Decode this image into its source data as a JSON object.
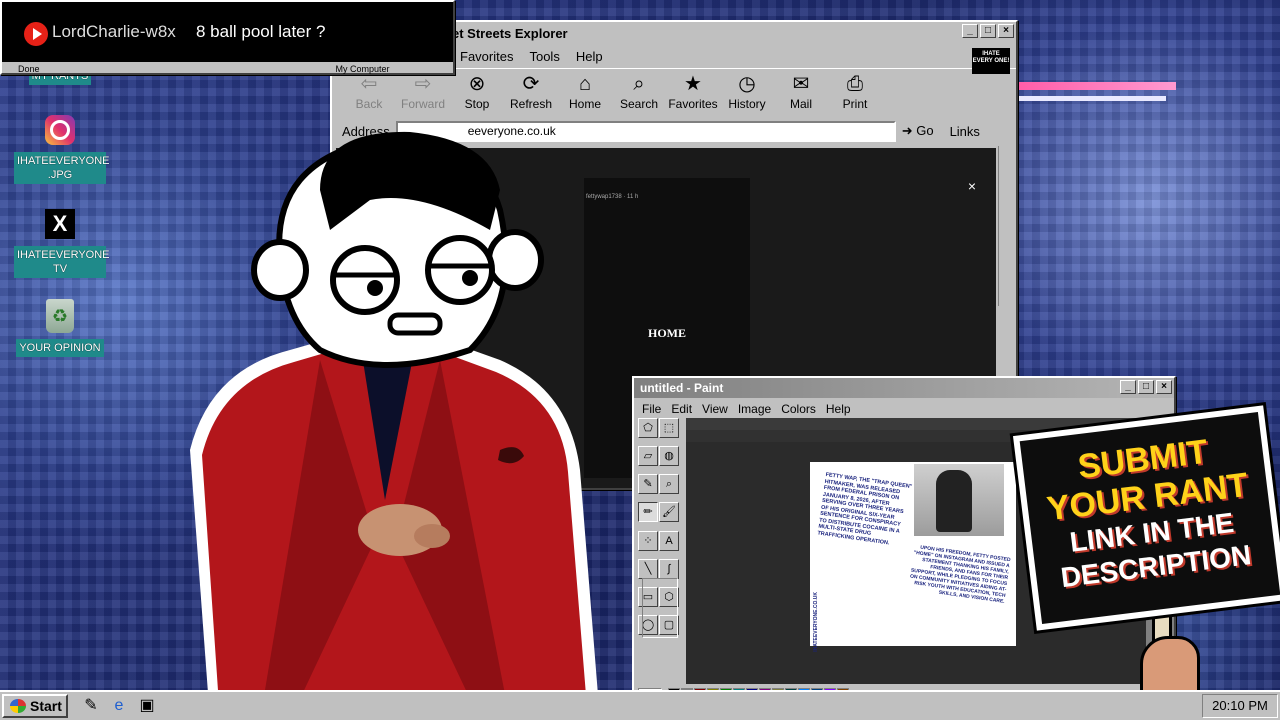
{
  "notification": {
    "username": "LordCharlie-w8x",
    "message": "8 ball pool later ?",
    "status_left": "Done",
    "status_right": "My Computer"
  },
  "desktop": {
    "icons": [
      {
        "label": "MY RANTS",
        "icon": "rants-icon"
      },
      {
        "label": "IHATEEVERYONE .JPG",
        "icon": "instagram-icon"
      },
      {
        "label": "IHATEEVERYONE TV",
        "icon": "x-logo-icon"
      },
      {
        "label": "YOUR OPINION",
        "icon": "recycle-bin-icon"
      }
    ]
  },
  "browser": {
    "title": "et Streets Explorer",
    "logo_text": "IHATE EVERY ONE!",
    "menu": [
      "Favorites",
      "Tools",
      "Help"
    ],
    "toolbar": [
      {
        "label": "Back",
        "icon": "back-arrow-icon",
        "enabled": false
      },
      {
        "label": "Forward",
        "icon": "forward-arrow-icon",
        "enabled": false
      },
      {
        "label": "Stop",
        "icon": "stop-icon",
        "enabled": true
      },
      {
        "label": "Refresh",
        "icon": "refresh-icon",
        "enabled": true
      },
      {
        "label": "Home",
        "icon": "home-icon",
        "enabled": true
      },
      {
        "label": "Search",
        "icon": "search-icon",
        "enabled": true
      },
      {
        "label": "Favorites",
        "icon": "favorites-icon",
        "enabled": true
      },
      {
        "label": "History",
        "icon": "history-icon",
        "enabled": true
      },
      {
        "label": "Mail",
        "icon": "mail-icon",
        "enabled": true
      },
      {
        "label": "Print",
        "icon": "print-icon",
        "enabled": true
      }
    ],
    "address_label": "Address",
    "address_value": "eeveryone.co.uk",
    "go_label": "Go",
    "links_label": "Links",
    "page": {
      "story_user": "fettywap1738",
      "story_time": "11 h",
      "home_text": "HOME"
    }
  },
  "paint": {
    "title": "untitled - Paint",
    "menu": [
      "File",
      "Edit",
      "View",
      "Image",
      "Colors",
      "Help"
    ],
    "document_text_1": "FETTY WAP, THE \"TRAP QUEEN\" HITMAKER, WAS RELEASED FROM FEDERAL PRISON ON JANUARY 8, 2026, AFTER SERVING OVER THREE YEARS OF HIS ORIGINAL SIX-YEAR SENTENCE FOR CONSPIRACY TO DISTRIBUTE COCAINE IN A MULTI-STATE DRUG TRAFFICKING OPERATION.",
    "document_text_2": "UPON HIS FREEDOM, FETTY POSTED \"HOME\" ON INSTAGRAM AND ISSUED A STATEMENT THANKING HIS FAMILY, FRIENDS, AND FANS FOR THEIR SUPPORT, WHILE PLEDGING TO FOCUS ON COMMUNITY INITIATIVES AIDING AT-RISK YOUTH WITH EDUCATION, TECH SKILLS, AND VISION CARE.",
    "document_side": "IHATEEVERYONE.CO.UK",
    "palette": [
      "#000000",
      "#808080",
      "#800000",
      "#808000",
      "#008000",
      "#008080",
      "#000080",
      "#800080",
      "#808040",
      "#004040",
      "#0080ff",
      "#004080",
      "#8000ff",
      "#804000",
      "#ffffff",
      "#c0c0c0",
      "#ff0000",
      "#ffff00",
      "#00ff00",
      "#00ffff",
      "#0000ff",
      "#ff00ff",
      "#ffff80",
      "#00ff80",
      "#80ffff",
      "#8080ff",
      "#ff0080",
      "#ff8040"
    ]
  },
  "sign": {
    "line1": "SUBMIT",
    "line2": "YOUR RANT",
    "line3": "LINK IN THE",
    "line4": "DESCRIPTION"
  },
  "taskbar": {
    "start_label": "Start",
    "clock": "20:10 PM"
  },
  "colors": {
    "titlebar_active": "#000080",
    "sign_yellow": "#ffd21a",
    "sign_red": "#c0392b",
    "jacket_red": "#b3161b"
  }
}
